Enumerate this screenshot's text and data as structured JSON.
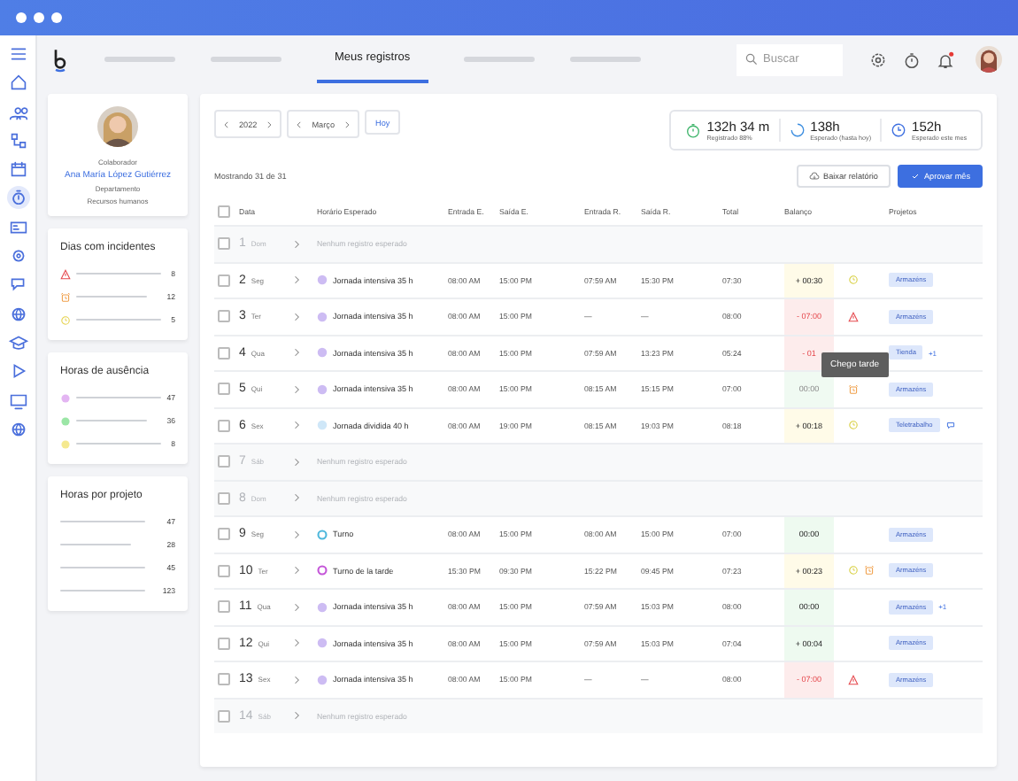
{
  "rail": [
    {
      "kind": "menu",
      "selected": false
    },
    {
      "kind": "home",
      "selected": false
    },
    {
      "kind": "users",
      "selected": false
    },
    {
      "kind": "org",
      "selected": false
    },
    {
      "kind": "calendar",
      "selected": false
    },
    {
      "kind": "stopwatch",
      "selected": true
    },
    {
      "kind": "card",
      "selected": false
    },
    {
      "kind": "gear",
      "selected": false
    },
    {
      "kind": "chat",
      "selected": false
    },
    {
      "kind": "globe",
      "selected": false
    },
    {
      "kind": "cap",
      "selected": false
    },
    {
      "kind": "play",
      "selected": false
    },
    {
      "kind": "monitor",
      "selected": false
    },
    {
      "kind": "globe",
      "selected": false
    }
  ],
  "nav": {
    "tabs": [
      {
        "selected": false
      },
      {
        "selected": false
      },
      {
        "label": "Meus registros",
        "selected": true
      },
      {
        "selected": false
      },
      {
        "selected": false
      }
    ],
    "search": {
      "placeholder": "Buscar"
    },
    "notification": true
  },
  "profile": {
    "role_label": "Colaborador",
    "name": "Ana María López Gutiérrez",
    "department_label": "Departamento",
    "department": "Recursos humanos"
  },
  "incidents": {
    "title": "Dias com incidentes",
    "items": [
      {
        "kind": "warning",
        "count": "8"
      },
      {
        "kind": "alarm",
        "count": "12"
      },
      {
        "kind": "clock",
        "count": "5"
      }
    ]
  },
  "absences": {
    "title": "Horas de ausência",
    "items": [
      {
        "color": "#e3b5f2",
        "count": "47"
      },
      {
        "color": "#9be6a6",
        "count": "36"
      },
      {
        "color": "#f5e98f",
        "count": "8"
      }
    ]
  },
  "projects": {
    "title": "Horas por projeto",
    "items": [
      {
        "count": "47"
      },
      {
        "count": "28"
      },
      {
        "count": "45"
      },
      {
        "count": "123"
      }
    ]
  },
  "filters": {
    "year": "2022",
    "month": "Março",
    "today": "Hoy"
  },
  "stats": [
    {
      "kind": "stopwatch",
      "value": "132h 34 m",
      "label": "Registrado 88%"
    },
    {
      "kind": "progress",
      "value": "138h",
      "label": "Esperado (hasta hoy)"
    },
    {
      "kind": "clock",
      "value": "152h",
      "label": "Esperado este mes"
    }
  ],
  "showing": "Mostrando 31 de 31",
  "buttons": {
    "download": "Baixar relatório",
    "approve": "Aprovar mês"
  },
  "select_all": {
    "checked": false
  },
  "columns": [
    "Data",
    "Horário Esperado",
    "Entrada E.",
    "Saída E.",
    "Entrada R.",
    "Saída R.",
    "Total",
    "Balanço",
    "Projetos"
  ],
  "rows": [
    {
      "kind": "empty",
      "checked": false,
      "day": "1",
      "weekday": "Dom",
      "note": "Nenhum registro esperado"
    },
    {
      "kind": "shift",
      "checked": false,
      "day": "2",
      "weekday": "Seg",
      "schedule": {
        "kind": "filled",
        "name": "Jornada intensiva 35 h",
        "color": "#cdbcf3"
      },
      "entry_e": "08:00 AM",
      "exit_e": "15:00 PM",
      "entry_r": "07:59 AM",
      "exit_r": "15:30 PM",
      "total": "07:30",
      "balance": {
        "kind": "over",
        "text": "+ 00:30"
      },
      "incidents": [
        {
          "kind": "clock"
        }
      ],
      "projects": [
        "Armazéns"
      ]
    },
    {
      "kind": "shift",
      "checked": false,
      "day": "3",
      "weekday": "Ter",
      "schedule": {
        "kind": "filled",
        "name": "Jornada intensiva 35 h",
        "color": "#cdbcf3"
      },
      "entry_e": "08:00 AM",
      "exit_e": "15:00 PM",
      "entry_r": "—",
      "exit_r": "—",
      "total": "08:00",
      "balance": {
        "kind": "short",
        "text": "- 07:00"
      },
      "incidents": [
        {
          "kind": "warning"
        }
      ],
      "projects": [
        "Armazéns"
      ]
    },
    {
      "kind": "shift",
      "checked": false,
      "day": "4",
      "weekday": "Qua",
      "schedule": {
        "kind": "filled",
        "name": "Jornada intensiva 35 h",
        "color": "#cdbcf3"
      },
      "entry_e": "08:00 AM",
      "exit_e": "15:00 PM",
      "entry_r": "07:59 AM",
      "exit_r": "13:23 PM",
      "total": "05:24",
      "balance": {
        "kind": "short",
        "text": "- 01"
      },
      "projects": [
        "Tienda"
      ],
      "more": "+1"
    },
    {
      "kind": "shift",
      "checked": false,
      "day": "5",
      "weekday": "Qui",
      "schedule": {
        "kind": "filled",
        "name": "Jornada intensiva 35 h",
        "color": "#cdbcf3"
      },
      "entry_e": "08:00 AM",
      "exit_e": "15:00 PM",
      "entry_r": "08:15 AM",
      "exit_r": "15:15 PM",
      "total": "07:00",
      "balance": {
        "kind": "even",
        "text": "00:00"
      },
      "incidents": [
        {
          "kind": "alarm"
        }
      ],
      "tooltip": "Chego tarde",
      "projects": [
        "Armazéns"
      ]
    },
    {
      "kind": "shift",
      "checked": false,
      "day": "6",
      "weekday": "Sex",
      "schedule": {
        "kind": "filled",
        "name": "Jornada dividida 40 h",
        "color": "#cfe7f8"
      },
      "entry_e": "08:00 AM",
      "exit_e": "19:00 PM",
      "entry_r": "08:15 AM",
      "exit_r": "19:03 PM",
      "total": "08:18",
      "balance": {
        "kind": "over",
        "text": "+ 00:18"
      },
      "incidents": [
        {
          "kind": "clock"
        }
      ],
      "projects": [
        "Teletrabalho"
      ],
      "comment": true
    },
    {
      "kind": "empty",
      "checked": false,
      "day": "7",
      "weekday": "Sáb",
      "note": "Nenhum registro esperado"
    },
    {
      "kind": "empty",
      "checked": false,
      "day": "8",
      "weekday": "Dom",
      "note": "Nenhum registro esperado"
    },
    {
      "kind": "shift",
      "checked": false,
      "day": "9",
      "weekday": "Seg",
      "schedule": {
        "kind": "ring",
        "name": "Turno",
        "color": "#4fb8dc"
      },
      "entry_e": "08:00 AM",
      "exit_e": "15:00 PM",
      "entry_r": "08:00 AM",
      "exit_r": "15:00 PM",
      "total": "07:00",
      "balance": {
        "kind": "ok",
        "text": "00:00"
      },
      "projects": [
        "Armazéns"
      ]
    },
    {
      "kind": "shift",
      "checked": false,
      "day": "10",
      "weekday": "Ter",
      "schedule": {
        "kind": "ring",
        "name": "Turno de la tarde",
        "color": "#c456d8"
      },
      "entry_e": "15:30 PM",
      "exit_e": "09:30 PM",
      "entry_r": "15:22 PM",
      "exit_r": "09:45 PM",
      "total": "07:23",
      "balance": {
        "kind": "over",
        "text": "+ 00:23"
      },
      "incidents": [
        {
          "kind": "clock"
        },
        {
          "kind": "alarm"
        }
      ],
      "projects": [
        "Armazéns"
      ]
    },
    {
      "kind": "shift",
      "checked": false,
      "day": "11",
      "weekday": "Qua",
      "schedule": {
        "kind": "filled",
        "name": "Jornada intensiva 35 h",
        "color": "#cdbcf3"
      },
      "entry_e": "08:00 AM",
      "exit_e": "15:00 PM",
      "entry_r": "07:59 AM",
      "exit_r": "15:03 PM",
      "total": "08:00",
      "balance": {
        "kind": "ok",
        "text": "00:00"
      },
      "projects": [
        "Armazéns"
      ],
      "more": "+1"
    },
    {
      "kind": "shift",
      "checked": false,
      "day": "12",
      "weekday": "Qui",
      "schedule": {
        "kind": "filled",
        "name": "Jornada intensiva 35 h",
        "color": "#cdbcf3"
      },
      "entry_e": "08:00 AM",
      "exit_e": "15:00 PM",
      "entry_r": "07:59 AM",
      "exit_r": "15:03 PM",
      "total": "07:04",
      "balance": {
        "kind": "ok",
        "text": "+ 00:04"
      },
      "projects": [
        "Armazéns"
      ]
    },
    {
      "kind": "shift",
      "checked": false,
      "day": "13",
      "weekday": "Sex",
      "schedule": {
        "kind": "filled",
        "name": "Jornada intensiva 35 h",
        "color": "#cdbcf3"
      },
      "entry_e": "08:00 AM",
      "exit_e": "15:00 PM",
      "entry_r": "—",
      "exit_r": "—",
      "total": "08:00",
      "balance": {
        "kind": "short",
        "text": "- 07:00"
      },
      "incidents": [
        {
          "kind": "warning"
        }
      ],
      "projects": [
        "Armazéns"
      ]
    },
    {
      "kind": "empty",
      "checked": false,
      "day": "14",
      "weekday": "Sáb",
      "note": "Nenhum registro esperado"
    }
  ]
}
